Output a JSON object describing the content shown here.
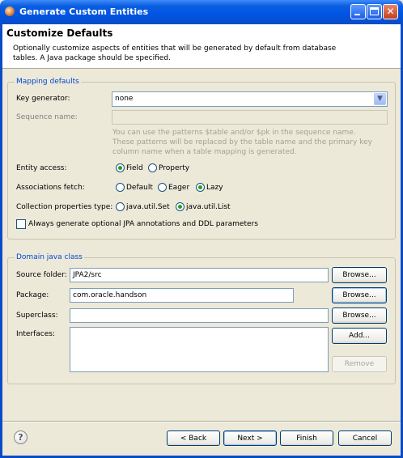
{
  "window": {
    "title": "Generate Custom Entities"
  },
  "header": {
    "title": "Customize Defaults",
    "description_line1": "Optionally customize aspects of entities that will be generated by default from database",
    "description_line2": "tables. A Java package should be specified."
  },
  "mapping": {
    "legend": "Mapping defaults",
    "key_generator_label": "Key generator:",
    "key_generator_value": "none",
    "sequence_name_label": "Sequence name:",
    "sequence_name_value": "",
    "hint_line1": "You can use the patterns $table and/or $pk in the sequence name.",
    "hint_line2": "These patterns will be replaced by the table name and the primary key",
    "hint_line3": "column name when a table mapping is generated.",
    "entity_access_label": "Entity access:",
    "entity_access_options": [
      "Field",
      "Property"
    ],
    "entity_access_selected": "Field",
    "associations_fetch_label": "Associations fetch:",
    "associations_fetch_options": [
      "Default",
      "Eager",
      "Lazy"
    ],
    "associations_fetch_selected": "Lazy",
    "collection_type_label": "Collection properties type:",
    "collection_type_options": [
      "java.util.Set",
      "java.util.List"
    ],
    "collection_type_selected": "java.util.List",
    "optional_annotations_label": "Always generate optional JPA annotations and DDL parameters",
    "optional_annotations_checked": false
  },
  "domain": {
    "legend": "Domain java class",
    "source_folder_label": "Source folder:",
    "source_folder_value": "JPA2/src",
    "package_label": "Package:",
    "package_value": "com.oracle.handson",
    "superclass_label": "Superclass:",
    "superclass_value": "",
    "interfaces_label": "Interfaces:",
    "browse_label": "Browse...",
    "add_label": "Add...",
    "remove_label": "Remove"
  },
  "footer": {
    "help_symbol": "?",
    "back_label": "< Back",
    "next_label": "Next >",
    "finish_label": "Finish",
    "cancel_label": "Cancel"
  }
}
